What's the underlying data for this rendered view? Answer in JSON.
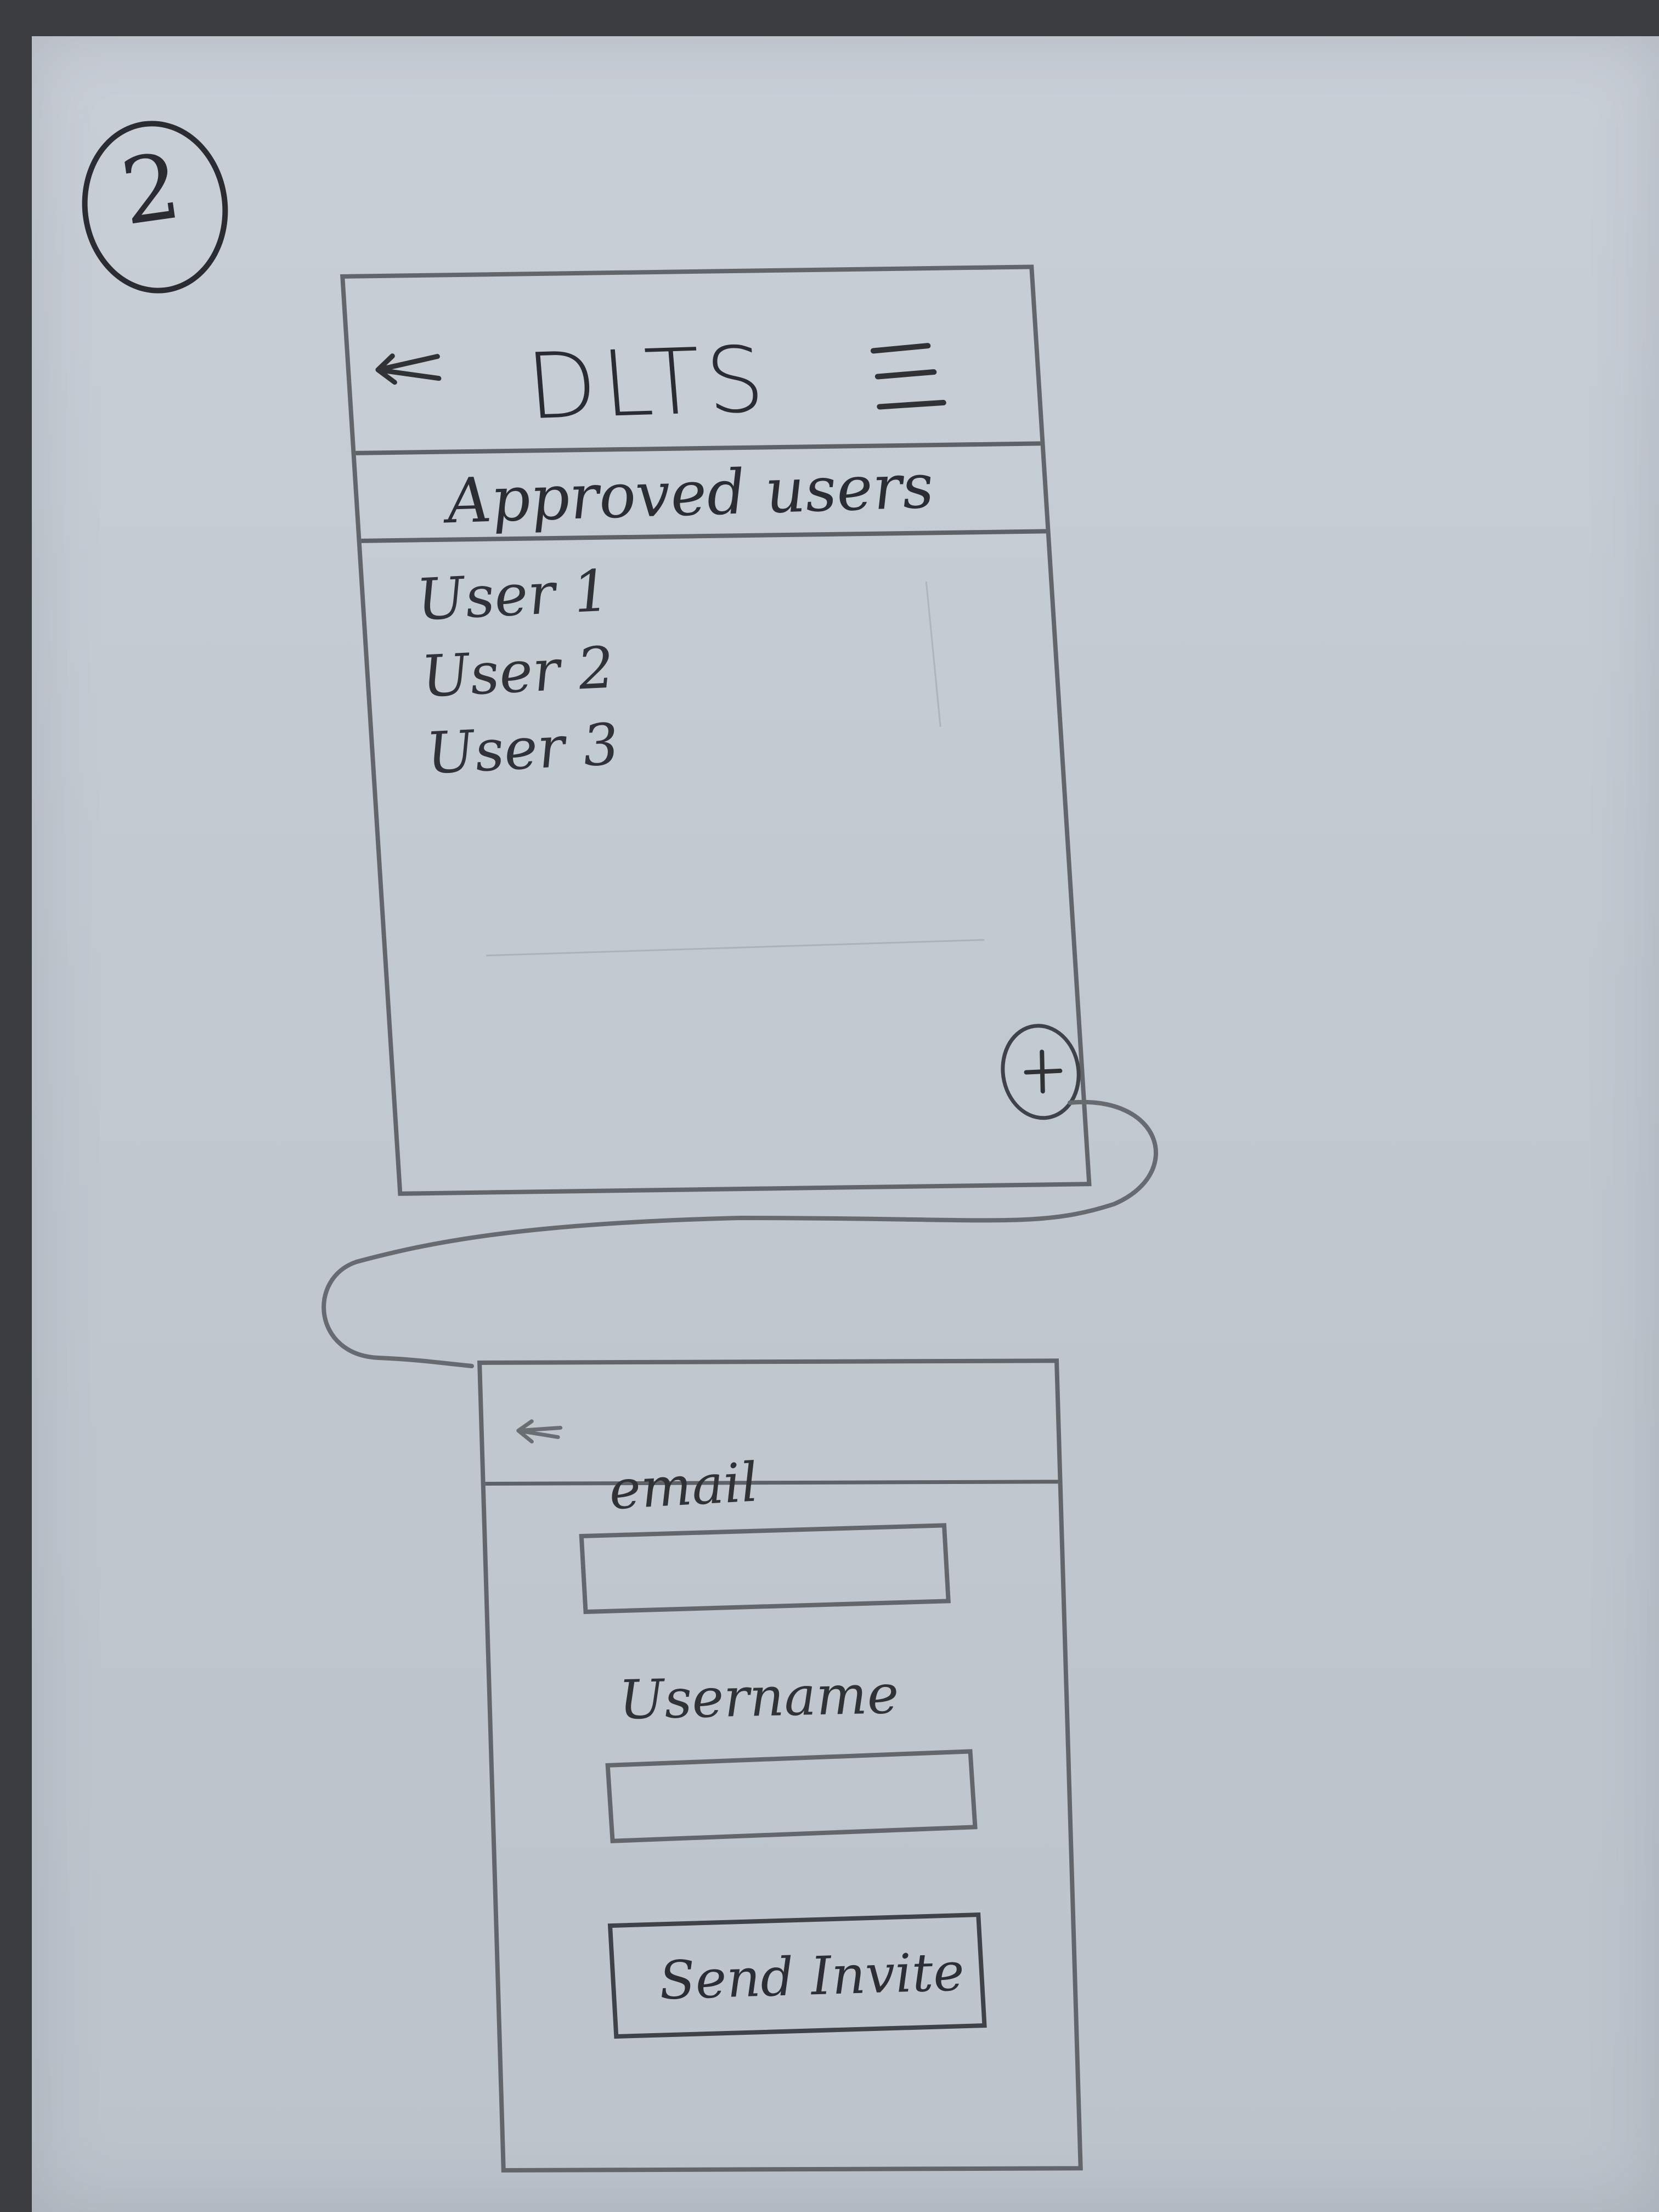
{
  "sketch": {
    "page_number": "2"
  },
  "approved_users_screen": {
    "title": "DLTS",
    "section_title": "Approved users",
    "users": [
      "User 1",
      "User 2",
      "User 3"
    ],
    "add_button_icon": "plus-icon",
    "back_icon": "back-arrow-icon",
    "menu_icon": "hamburger-menu-icon"
  },
  "invite_screen": {
    "back_icon": "back-arrow-icon",
    "email": {
      "label": "email",
      "value": "",
      "placeholder": ""
    },
    "username": {
      "label": "Username",
      "value": "",
      "placeholder": ""
    },
    "send_invite": "Send Invite"
  },
  "colors": {
    "paper": "#c6ccd4",
    "pencil": "#2f3136",
    "light_pencil": "#6a6e73",
    "background": "#3b3d41"
  }
}
